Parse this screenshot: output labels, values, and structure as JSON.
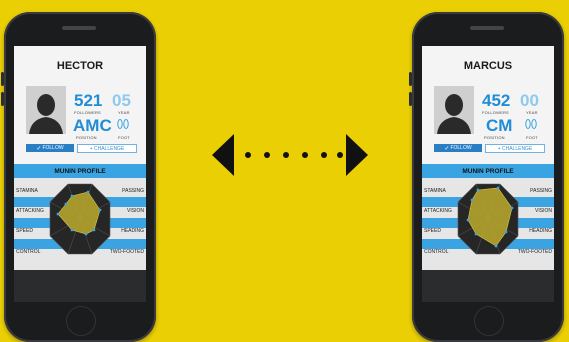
{
  "profiles": [
    {
      "name": "HECTOR",
      "followers": "521",
      "followers_label": "FOLLOWERS",
      "position": "AMC",
      "position_label": "POSITION",
      "year": "05",
      "year_label": "YEAR",
      "foot_label": "FOOT",
      "follow_label": "FOLLOW",
      "challenge_label": "+ CHALLENGE",
      "section_title": "MUNIN PROFILE",
      "attributes_left": [
        "STAMINA",
        "ATTACKING",
        "SPEED",
        "CONTROL"
      ],
      "attributes_right": [
        "PASSING",
        "VISION",
        "HEADING",
        "TWO-FOOTED"
      ]
    },
    {
      "name": "MARCUS",
      "followers": "452",
      "followers_label": "FOLLOWERS",
      "position": "CM",
      "position_label": "POSITION",
      "year": "00",
      "year_label": "YEAR",
      "foot_label": "FOOT",
      "follow_label": "FOLLOW",
      "challenge_label": "+ CHALLENGE",
      "section_title": "MUNIN PROFILE",
      "attributes_left": [
        "STAMINA",
        "ATTACKING",
        "SPEED",
        "CONTROL"
      ],
      "attributes_right": [
        "PASSING",
        "VISION",
        "HEADING",
        "TWO-FOOTED"
      ]
    }
  ],
  "colors": {
    "background": "#ebcf05",
    "accent": "#3aa4e3",
    "radar_fill": "#b5a42e",
    "phone": "#1b1c1e"
  },
  "icons": [
    "person-silhouette-icon",
    "footprints-icon",
    "checkmark-icon",
    "double-arrow-icon"
  ]
}
